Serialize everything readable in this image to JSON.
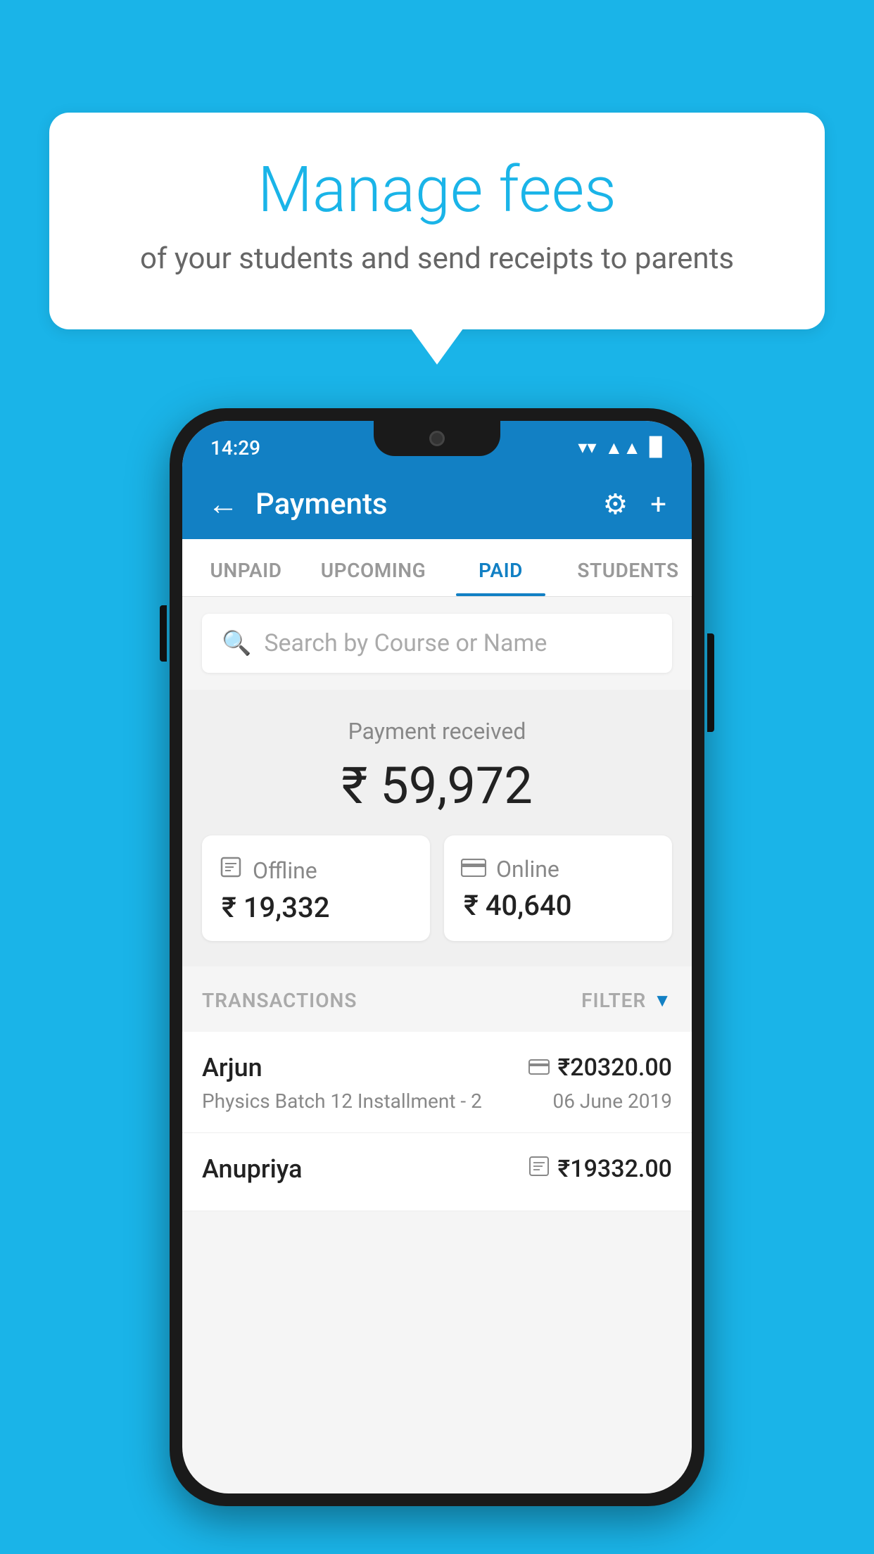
{
  "background_color": "#1ab4e8",
  "speech_bubble": {
    "title": "Manage fees",
    "subtitle": "of your students and send receipts to parents"
  },
  "status_bar": {
    "time": "14:29",
    "wifi_symbol": "▼",
    "signal_symbol": "▲",
    "battery_symbol": "▉"
  },
  "header": {
    "title": "Payments",
    "back_label": "←",
    "gear_label": "⚙",
    "plus_label": "+"
  },
  "tabs": [
    {
      "label": "UNPAID",
      "active": false
    },
    {
      "label": "UPCOMING",
      "active": false
    },
    {
      "label": "PAID",
      "active": true
    },
    {
      "label": "STUDENTS",
      "active": false
    }
  ],
  "search": {
    "placeholder": "Search by Course or Name"
  },
  "payment_summary": {
    "label": "Payment received",
    "amount": "₹ 59,972",
    "offline": {
      "icon": "💳",
      "label": "Offline",
      "amount": "₹ 19,332"
    },
    "online": {
      "icon": "💳",
      "label": "Online",
      "amount": "₹ 40,640"
    }
  },
  "transactions": {
    "label": "TRANSACTIONS",
    "filter_label": "FILTER",
    "items": [
      {
        "name": "Arjun",
        "course": "Physics Batch 12 Installment - 2",
        "amount": "₹20320.00",
        "date": "06 June 2019",
        "payment_type": "online"
      },
      {
        "name": "Anupriya",
        "course": "",
        "amount": "₹19332.00",
        "date": "",
        "payment_type": "offline"
      }
    ]
  }
}
